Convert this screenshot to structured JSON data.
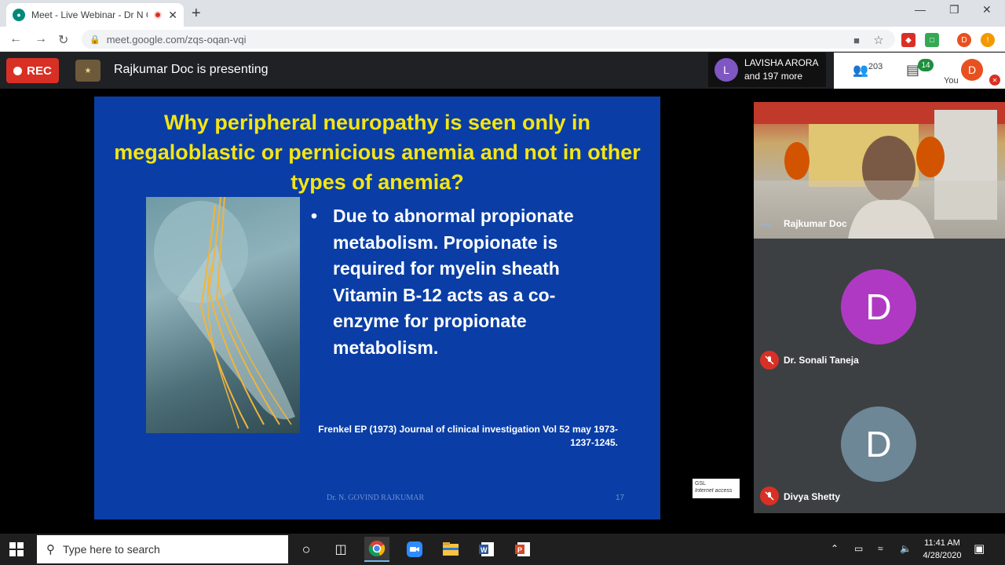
{
  "browser": {
    "tab_title": "Meet - Live Webinar - Dr N C",
    "new_tab": "+",
    "url": "meet.google.com/zqs-oqan-vqi",
    "profile_initial": "D"
  },
  "meet": {
    "rec_label": "REC",
    "presenter_text": "Rajkumar Doc is presenting",
    "participants_name": "LAVISHA ARORA",
    "participants_more": "and 197 more",
    "people_count": "203",
    "chat_count": "14",
    "you_label": "You",
    "you_initial": "D"
  },
  "slide": {
    "title": "Why peripheral neuropathy is seen only in megaloblastic or pernicious anemia and not in other types of anemia?",
    "bullet": "Due to abnormal propionate metabolism. Propionate is required for myelin sheath Vitamin B-12 acts as a co-enzyme  for propionate metabolism.",
    "reference_line1": "Frenkel EP (1973) Journal of clinical investigation  Vol 52 may 1973-",
    "reference_line2": "1237-1245.",
    "footer": "Dr. N. GOVIND RAJKUMAR",
    "number": "17"
  },
  "watermark": {
    "line1": "GSL",
    "line2": "Internet access"
  },
  "tiles": [
    {
      "name": "Rajkumar Doc"
    },
    {
      "name": "Dr. Sonali Taneja",
      "initial": "D",
      "color": "#b039c3"
    },
    {
      "name": "Divya Shetty",
      "initial": "D",
      "color": "#6d8796"
    }
  ],
  "taskbar": {
    "search_placeholder": "Type here to search",
    "time": "11:41 AM",
    "date": "4/28/2020"
  }
}
